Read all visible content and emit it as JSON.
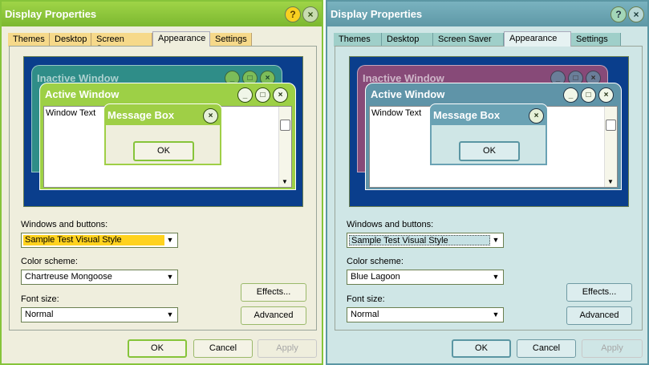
{
  "windows": [
    {
      "title": "Display Properties",
      "tabs": [
        "Themes",
        "Desktop",
        "Screen Saver",
        "Appearance",
        "Settings"
      ],
      "preview": {
        "inactive_title": "Inactive Window",
        "active_title": "Active Window",
        "window_text": "Window Text",
        "message_title": "Message Box",
        "ok_label": "OK"
      },
      "windows_buttons_label": "Windows and buttons:",
      "windows_buttons_value": "Sample Test Visual Style",
      "color_scheme_label": "Color scheme:",
      "color_scheme_value": "Chartreuse Mongoose",
      "font_size_label": "Font size:",
      "font_size_value": "Normal",
      "effects_label": "Effects...",
      "advanced_label": "Advanced",
      "ok_label": "OK",
      "cancel_label": "Cancel",
      "apply_label": "Apply",
      "accent_color": "#86c43a"
    },
    {
      "title": "Display Properties",
      "tabs": [
        "Themes",
        "Desktop",
        "Screen Saver",
        "Appearance",
        "Settings"
      ],
      "preview": {
        "inactive_title": "Inactive Window",
        "active_title": "Active Window",
        "window_text": "Window Text",
        "message_title": "Message Box",
        "ok_label": "OK"
      },
      "windows_buttons_label": "Windows and buttons:",
      "windows_buttons_value": "Sample Test Visual Style",
      "color_scheme_label": "Color scheme:",
      "color_scheme_value": "Blue Lagoon",
      "font_size_label": "Font size:",
      "font_size_value": "Normal",
      "effects_label": "Effects...",
      "advanced_label": "Advanced",
      "ok_label": "OK",
      "cancel_label": "Cancel",
      "apply_label": "Apply",
      "accent_color": "#5b96a3"
    }
  ],
  "icons": {
    "help": "?",
    "close": "×",
    "minimize": "_",
    "maximize": "□",
    "dropdown": "▼",
    "scroll_down": "▼"
  }
}
